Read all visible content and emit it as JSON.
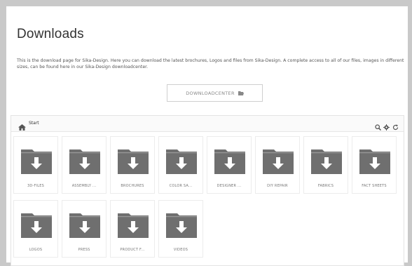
{
  "page": {
    "title": "Downloads",
    "intro": "This is the download page for Sika-Design. Here you can download the latest brochures, Logos and files from Sika-Design. A complete access to all of our files, images in different sizes, can be found here in our Sika-Design downloadcenter.",
    "downloadcenter_button": "DOWNLOADCENTER"
  },
  "browser": {
    "breadcrumb": "Start",
    "tools": [
      "search-icon",
      "gear-icon",
      "refresh-icon"
    ],
    "folders": [
      {
        "label": "3D-FILES"
      },
      {
        "label": "ASSEMBLY ..."
      },
      {
        "label": "BROCHURES"
      },
      {
        "label": "COLOR SA..."
      },
      {
        "label": "DESIGNER ..."
      },
      {
        "label": "DIY REPAIR"
      },
      {
        "label": "FABRICS"
      },
      {
        "label": "FACT SHEETS"
      },
      {
        "label": "LOGOS"
      },
      {
        "label": "PRESS"
      },
      {
        "label": "PRODUCT F..."
      },
      {
        "label": "VIDEOS"
      }
    ]
  },
  "colors": {
    "background": "#c9c9c9",
    "folder": "#6f6f6f",
    "text": "#333333"
  }
}
